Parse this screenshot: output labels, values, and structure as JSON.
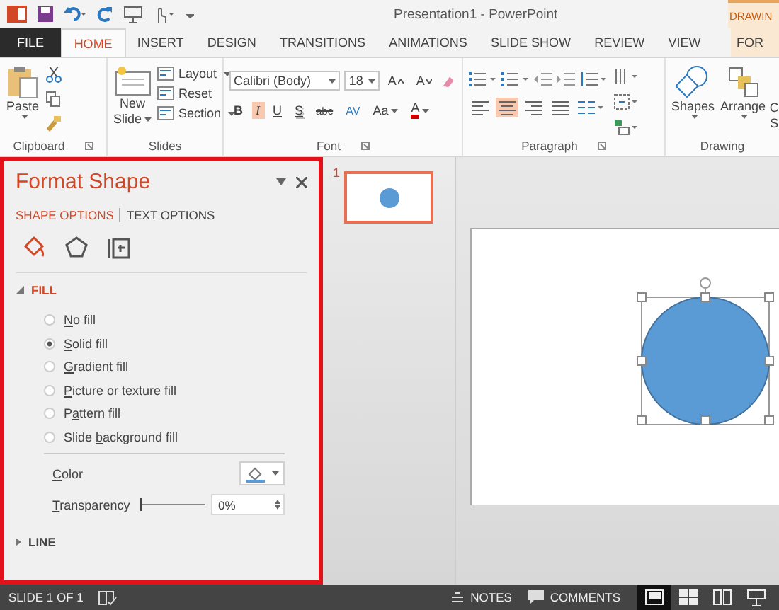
{
  "title_bar": {
    "title": "Presentation1 - PowerPoint",
    "contextual_label": "DRAWIN"
  },
  "tabs": [
    {
      "label": "FILE",
      "kind": "file",
      "selected": false
    },
    {
      "label": "HOME",
      "kind": "normal",
      "selected": true
    },
    {
      "label": "INSERT",
      "kind": "normal",
      "selected": false
    },
    {
      "label": "DESIGN",
      "kind": "normal",
      "selected": false
    },
    {
      "label": "TRANSITIONS",
      "kind": "normal",
      "selected": false
    },
    {
      "label": "ANIMATIONS",
      "kind": "normal",
      "selected": false
    },
    {
      "label": "SLIDE SHOW",
      "kind": "normal",
      "selected": false
    },
    {
      "label": "REVIEW",
      "kind": "normal",
      "selected": false
    },
    {
      "label": "VIEW",
      "kind": "normal",
      "selected": false
    },
    {
      "label": "FOR",
      "kind": "contextual",
      "selected": false
    }
  ],
  "ribbon": {
    "clipboard": {
      "label": "Clipboard",
      "paste": "Paste"
    },
    "slides": {
      "label": "Slides",
      "new_slide": [
        "New",
        "Slide"
      ],
      "commands": [
        {
          "label": "Layout",
          "dropdown": true
        },
        {
          "label": "Reset",
          "dropdown": false
        },
        {
          "label": "Section",
          "dropdown": true
        }
      ]
    },
    "font": {
      "label": "Font",
      "font_name": "Calibri (Body)",
      "font_size": "18",
      "grow": "A",
      "shrink": "A",
      "styles": [
        {
          "label": "B",
          "kind": "bold",
          "selected": false
        },
        {
          "label": "I",
          "kind": "italic",
          "selected": true
        },
        {
          "label": "U",
          "kind": "underline",
          "selected": false
        },
        {
          "label": "S",
          "kind": "shadow",
          "selected": false
        },
        {
          "label": "abc",
          "kind": "strike",
          "selected": false
        },
        {
          "label": "AV",
          "kind": "spacing",
          "selected": false
        }
      ],
      "case": "Aa",
      "color_letter": "A"
    },
    "paragraph": {
      "label": "Paragraph",
      "alignment": [
        {
          "kind": "left",
          "selected": false
        },
        {
          "kind": "center",
          "selected": true
        },
        {
          "kind": "right",
          "selected": false
        },
        {
          "kind": "justify",
          "selected": false
        }
      ]
    },
    "drawing": {
      "label": "Drawing",
      "commands": [
        "Shapes",
        "Arrange"
      ],
      "cut_off_lines": [
        "C",
        "S"
      ]
    }
  },
  "format_pane": {
    "title": "Format Shape",
    "option_tabs": [
      {
        "label": "SHAPE OPTIONS",
        "selected": true
      },
      {
        "label": "TEXT OPTIONS",
        "selected": false
      }
    ],
    "icon_tabs": [
      {
        "kind": "fill",
        "selected": true
      },
      {
        "kind": "effects",
        "selected": false
      },
      {
        "kind": "size",
        "selected": false
      }
    ],
    "fill_section": {
      "label": "FILL",
      "expanded": true,
      "options": [
        {
          "key": "N",
          "post": "o fill",
          "selected": false
        },
        {
          "key": "S",
          "post": "olid fill",
          "selected": true
        },
        {
          "key": "G",
          "post": "radient fill",
          "selected": false
        },
        {
          "key": "P",
          "post": "icture or texture fill",
          "selected": false
        },
        {
          "pre": "P",
          "key": "a",
          "post": "ttern fill",
          "selected": false
        },
        {
          "pre": "Slide ",
          "key": "b",
          "post": "ackground fill",
          "selected": false
        }
      ],
      "color": {
        "key": "C",
        "post": "olor"
      },
      "transparency": {
        "key": "T",
        "post": "ransparency",
        "level": 0,
        "value": "0%"
      }
    },
    "line_section": {
      "label": "LINE",
      "expanded": false
    }
  },
  "thumbnails": [
    {
      "number": "1",
      "selected": true
    }
  ],
  "status_bar": {
    "slide_info": "SLIDE 1 OF 1",
    "notes": "NOTES",
    "comments": "COMMENTS",
    "views": [
      {
        "kind": "normal",
        "selected": true
      },
      {
        "kind": "sorter",
        "selected": false
      },
      {
        "kind": "reading",
        "selected": false
      },
      {
        "kind": "slideshow",
        "selected": false
      }
    ]
  }
}
